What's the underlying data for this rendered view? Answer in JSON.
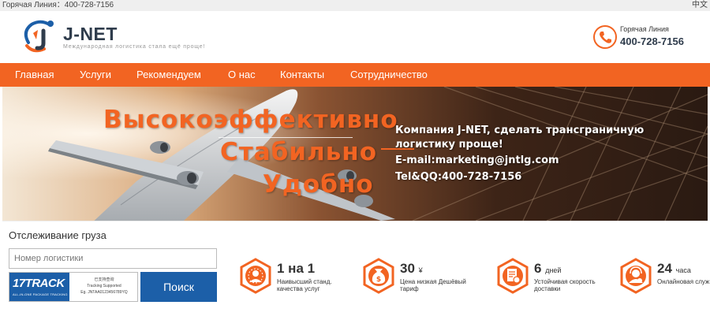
{
  "topbar": {
    "hotline": "Горячая Линия：400-728-7156",
    "language": "中文"
  },
  "header": {
    "brand": "J-NET",
    "slogan": "Международная логистика стала ещё проще!",
    "phone_label": "Горячая Линия",
    "phone_number": "400-728-7156"
  },
  "nav": {
    "items": [
      {
        "label": "Главная"
      },
      {
        "label": "Услуги"
      },
      {
        "label": "Рекомендуем"
      },
      {
        "label": "О нас"
      },
      {
        "label": "Контакты"
      },
      {
        "label": "Сотрудничество"
      }
    ]
  },
  "banner": {
    "words": [
      "Высокоэффективно",
      "Стабильно",
      "Удобно"
    ],
    "lines": [
      "Компания J-NET, сделать трансграничную",
      "логистику проще!",
      "E-mail:marketing@jntlg.com",
      "Tel&QQ:400-728-7156"
    ]
  },
  "tracking": {
    "title": "Отслеживание груза",
    "placeholder": "Номер логистики",
    "brand_17track": "17TRACK",
    "brand_tag": "ALL-IN-ONE PACKAGE TRACKING",
    "supported_cn": "已支持查询",
    "supported_en": "Tracking Supported",
    "example": "Eg. JNTAA0123456789YQ",
    "search_label": "Поиск"
  },
  "features": [
    {
      "main": "1 на 1",
      "unit": "",
      "desc": "Наивысший станд. качества услуг"
    },
    {
      "main": "30",
      "unit": "¥",
      "desc": "Цена низкая Дешёвый тариф"
    },
    {
      "main": "6",
      "unit": "дней",
      "desc": "Устойчивая скорость доставки"
    },
    {
      "main": "24",
      "unit": "часа",
      "desc": "Онлайновая служба"
    }
  ],
  "colors": {
    "accent": "#f26422",
    "blue": "#1c5fa8",
    "dark": "#2f3c4c"
  }
}
